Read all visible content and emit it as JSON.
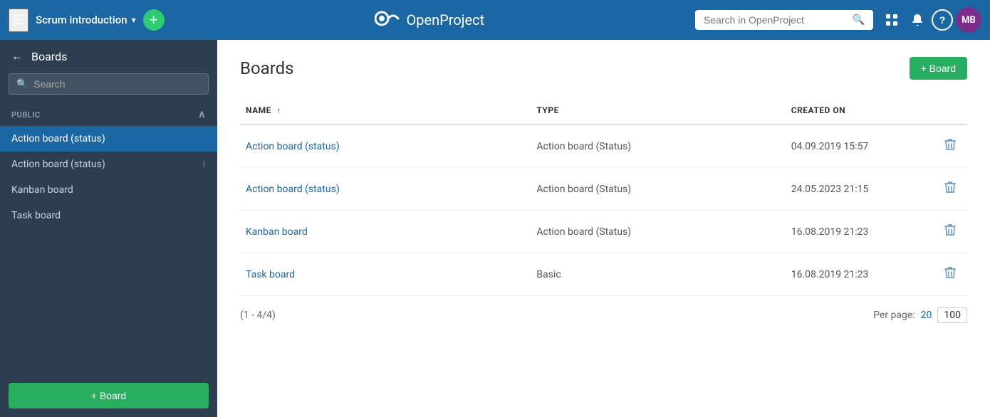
{
  "nav": {
    "hamburger_label": "☰",
    "project_name": "Scrum introduction",
    "project_chevron": "▾",
    "add_btn": "+",
    "logo_text": "OpenProject",
    "search_placeholder": "Search in OpenProject",
    "search_icon": "🔍",
    "grid_icon": "⊞",
    "bell_icon": "🔔",
    "help_icon": "?",
    "avatar_initials": "MB"
  },
  "sidebar": {
    "back_label": "←",
    "title": "Boards",
    "search_placeholder": "Search",
    "section_label": "PUBLIC",
    "section_chevron": "∧",
    "items": [
      {
        "label": "Action board (status)",
        "active": true
      },
      {
        "label": "Action board (status)",
        "active": false
      },
      {
        "label": "Kanban board",
        "active": false
      },
      {
        "label": "Task board",
        "active": false
      }
    ],
    "add_board_label": "+ Board"
  },
  "content": {
    "title": "Boards",
    "add_board_label": "+ Board",
    "table": {
      "columns": [
        {
          "key": "name",
          "label": "NAME",
          "sortable": true,
          "sort_arrow": "↑"
        },
        {
          "key": "type",
          "label": "TYPE",
          "sortable": false
        },
        {
          "key": "created_on",
          "label": "CREATED ON",
          "sortable": false
        },
        {
          "key": "action",
          "label": "",
          "sortable": false
        }
      ],
      "rows": [
        {
          "name": "Action board (status)",
          "type": "Action board (Status)",
          "created_on": "04.09.2019 15:57"
        },
        {
          "name": "Action board (status)",
          "type": "Action board (Status)",
          "created_on": "24.05.2023 21:15"
        },
        {
          "name": "Kanban board",
          "type": "Action board (Status)",
          "created_on": "16.08.2019 21:23"
        },
        {
          "name": "Task board",
          "type": "Basic",
          "created_on": "16.08.2019 21:23"
        }
      ],
      "pagination_text": "(1 - 4/4)",
      "per_page_label": "Per page:",
      "per_page_20": "20",
      "per_page_100": "100"
    }
  }
}
